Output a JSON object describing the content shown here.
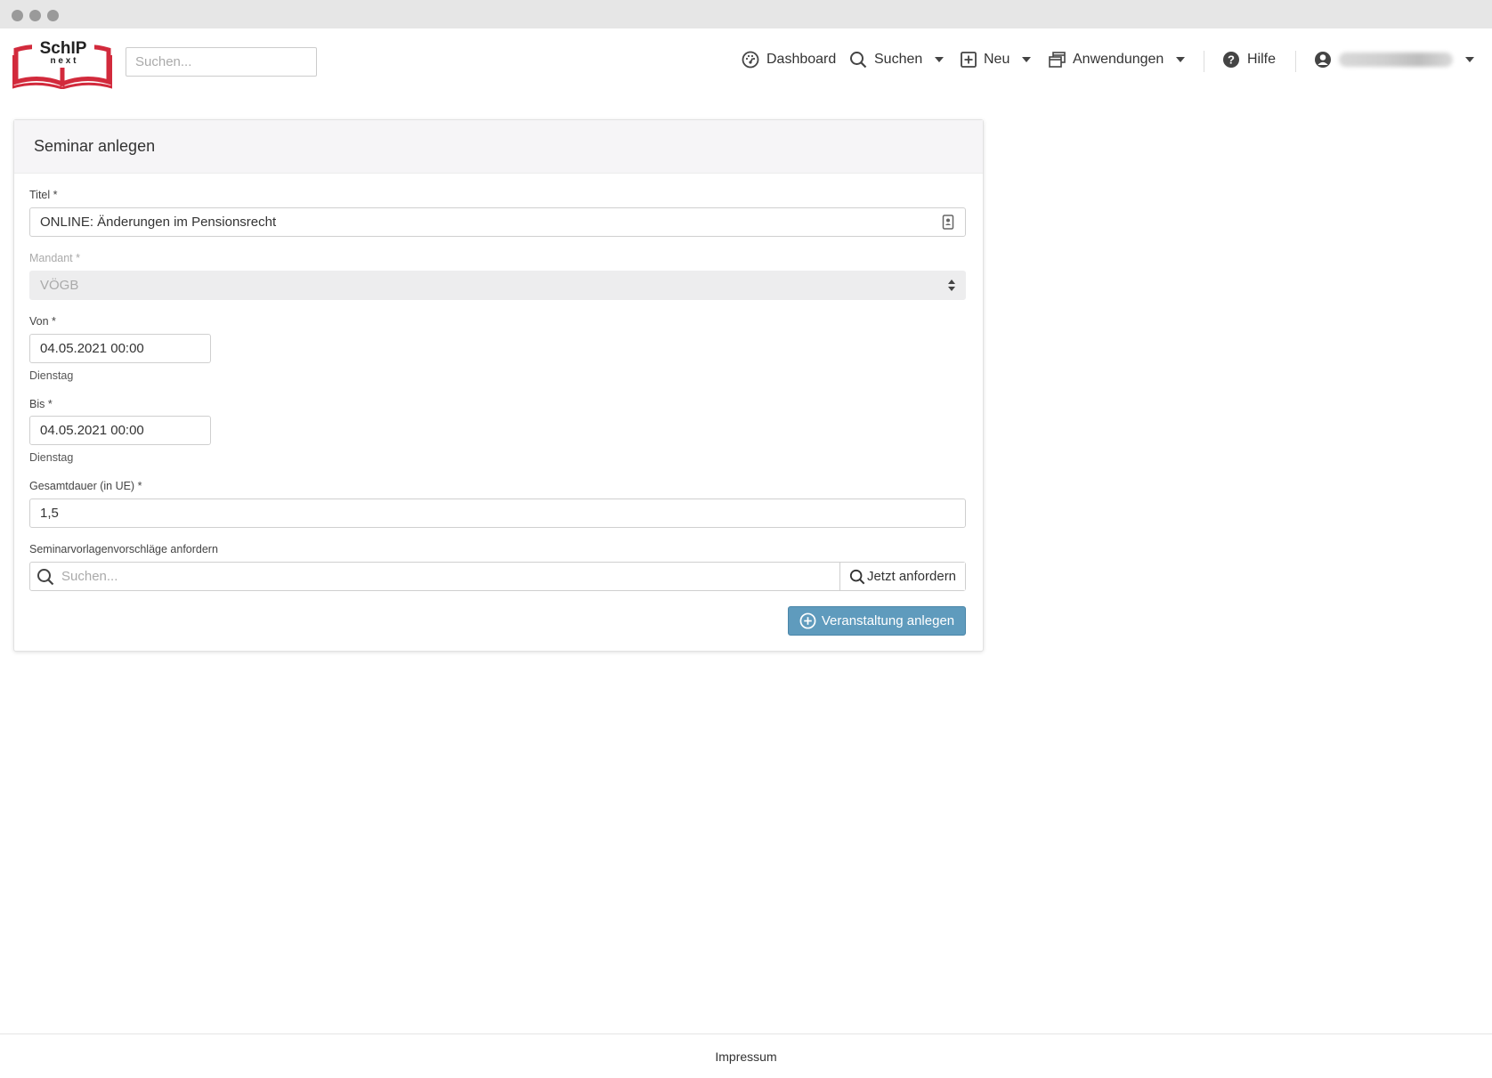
{
  "header": {
    "logo_text_main": "SchIP",
    "logo_text_sub": "n e x t",
    "search_placeholder": "Suchen...",
    "nav": {
      "dashboard": "Dashboard",
      "suchen": "Suchen",
      "neu": "Neu",
      "anwendungen": "Anwendungen",
      "hilfe": "Hilfe"
    }
  },
  "form": {
    "title": "Seminar anlegen",
    "titel_label": "Titel *",
    "titel_value": "ONLINE: Änderungen im Pensionsrecht",
    "mandant_label": "Mandant *",
    "mandant_value": "VÖGB",
    "von_label": "Von *",
    "von_value": "04.05.2021 00:00",
    "von_day": "Dienstag",
    "bis_label": "Bis *",
    "bis_value": "04.05.2021 00:00",
    "bis_day": "Dienstag",
    "dauer_label": "Gesamtdauer (in UE) *",
    "dauer_value": "1,5",
    "vorlagen_label": "Seminarvorlagenvorschläge anfordern",
    "vorlagen_placeholder": "Suchen...",
    "vorlagen_button": "Jetzt anfordern",
    "submit_button": "Veranstaltung anlegen"
  },
  "footer": {
    "impressum": "Impressum"
  },
  "colors": {
    "primary_button": "#5f9bbd",
    "logo_red": "#d22a3c"
  }
}
